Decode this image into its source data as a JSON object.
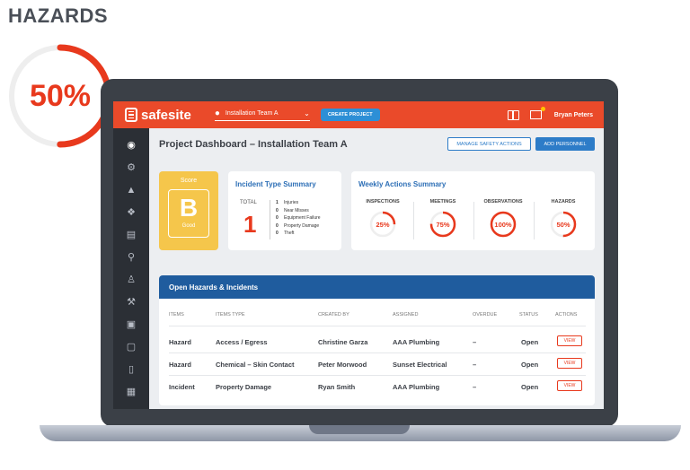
{
  "hero": {
    "title": "HAZARDS",
    "percent": "50%",
    "fraction": 0.5,
    "ring_color": "#e8391d"
  },
  "topbar": {
    "logo": "safesite",
    "team_select": "Installation Team A",
    "create_project": "CREATE PROJECT",
    "user_name": "Bryan Peters",
    "color": "#ea4a2a"
  },
  "header": {
    "title": "Project Dashboard – Installation Team A",
    "manage_safety_actions": "MANAGE SAFETY ACTIONS",
    "add_personnel": "ADD PERSONNEL"
  },
  "score": {
    "label": "Score",
    "grade": "B",
    "word": "Good"
  },
  "incident_summary": {
    "title": "Incident Type Summary",
    "total_label": "TOTAL",
    "total": "1",
    "types": [
      {
        "count": "1",
        "name": "Injuries"
      },
      {
        "count": "0",
        "name": "Near Misses"
      },
      {
        "count": "0",
        "name": "Equipment Failure"
      },
      {
        "count": "0",
        "name": "Property Damage"
      },
      {
        "count": "0",
        "name": "Theft"
      }
    ]
  },
  "weekly": {
    "title": "Weekly Actions Summary",
    "items": [
      {
        "label": "INSPECTIONS",
        "value": "25%",
        "fraction": 0.25
      },
      {
        "label": "MEETINGS",
        "value": "75%",
        "fraction": 0.75
      },
      {
        "label": "OBSERVATIONS",
        "value": "100%",
        "fraction": 1.0
      },
      {
        "label": "HAZARDS",
        "value": "50%",
        "fraction": 0.5
      }
    ]
  },
  "hazards_table": {
    "title": "Open Hazards & Incidents",
    "columns": [
      "ITEMS",
      "ITEMS TYPE",
      "CREATED BY",
      "ASSIGNED",
      "OVERDUE",
      "STATUS",
      "ACTIONS"
    ],
    "rows": [
      {
        "item": "Hazard",
        "type": "Access / Egress",
        "created_by": "Christine Garza",
        "assigned": "AAA Plumbing",
        "overdue": "–",
        "status": "Open",
        "action": "VIEW"
      },
      {
        "item": "Hazard",
        "type": "Chemical – Skin Contact",
        "created_by": "Peter Morwood",
        "assigned": "Sunset Electrical",
        "overdue": "–",
        "status": "Open",
        "action": "VIEW"
      },
      {
        "item": "Incident",
        "type": "Property Damage",
        "created_by": "Ryan Smith",
        "assigned": "AAA Plumbing",
        "overdue": "–",
        "status": "Open",
        "action": "VIEW"
      }
    ]
  },
  "sidebar": {
    "icons": [
      "dashboard-icon",
      "settings-icon",
      "hazard-warning-icon",
      "safety-vest-icon",
      "checklist-icon",
      "search-icon",
      "team-icon",
      "tool-icon",
      "document-icon",
      "presentation-icon",
      "mobile-icon",
      "building-icon"
    ]
  }
}
